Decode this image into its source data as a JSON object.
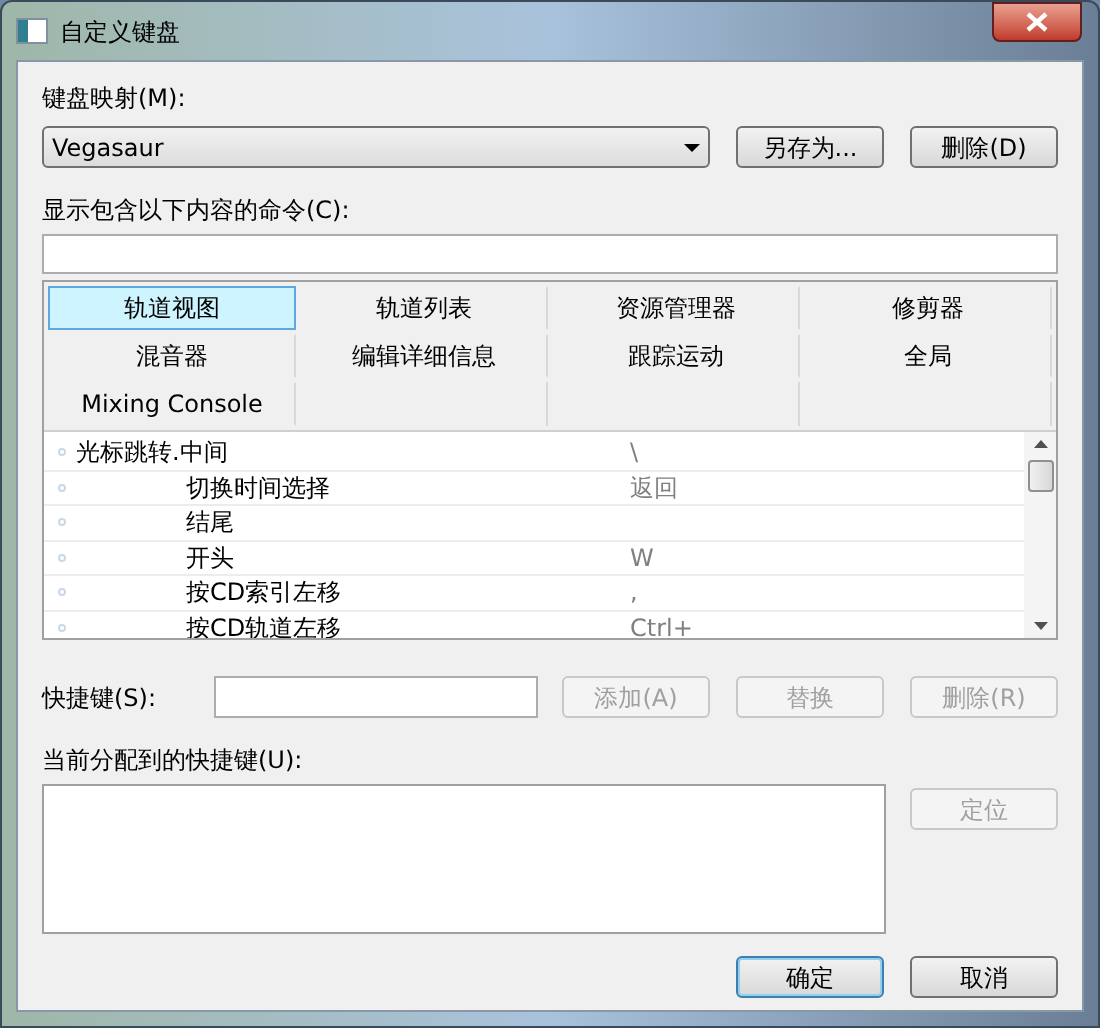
{
  "window": {
    "title": "自定义键盘"
  },
  "keymap": {
    "label": "键盘映射(M):",
    "value": "Vegasaur",
    "buttons": [
      {
        "label": "另存为...",
        "disabled": false
      },
      {
        "label": "删除(D)",
        "disabled": false
      }
    ]
  },
  "filter": {
    "label": "显示包含以下内容的命令(C):"
  },
  "tabs": [
    {
      "label": "轨道视图",
      "selected": true
    },
    {
      "label": "轨道列表",
      "selected": false
    },
    {
      "label": "资源管理器",
      "selected": false
    },
    {
      "label": "修剪器",
      "selected": false
    },
    {
      "label": "混音器",
      "selected": false
    },
    {
      "label": "编辑详细信息",
      "selected": false
    },
    {
      "label": "跟踪运动",
      "selected": false
    },
    {
      "label": "全局",
      "selected": false
    },
    {
      "label": "Mixing Console",
      "selected": false
    }
  ],
  "commands": [
    {
      "name": "光标跳转.中间",
      "shortcut": "\\",
      "children": [
        {
          "name": "切换时间选择",
          "shortcut": "返回"
        },
        {
          "name": "结尾"
        },
        {
          "name": "开头",
          "shortcut": "W"
        },
        {
          "name": "按CD索引左移",
          "shortcut": ","
        },
        {
          "name": "按CD轨道左移",
          "shortcut": "Ctrl+"
        }
      ]
    }
  ],
  "shortcut": {
    "label": "快捷键(S):",
    "buttons": [
      {
        "label": "添加(A)",
        "disabled": true
      },
      {
        "label": "替换",
        "disabled": true
      },
      {
        "label": "删除(R)",
        "disabled": true
      }
    ]
  },
  "assigned": {
    "label": "当前分配到的快捷键(U):",
    "buttons": [
      {
        "label": "定位",
        "disabled": true
      }
    ]
  },
  "footer": {
    "buttons": [
      {
        "label": "确定",
        "default": true
      },
      {
        "label": "取消",
        "default": false
      }
    ]
  }
}
